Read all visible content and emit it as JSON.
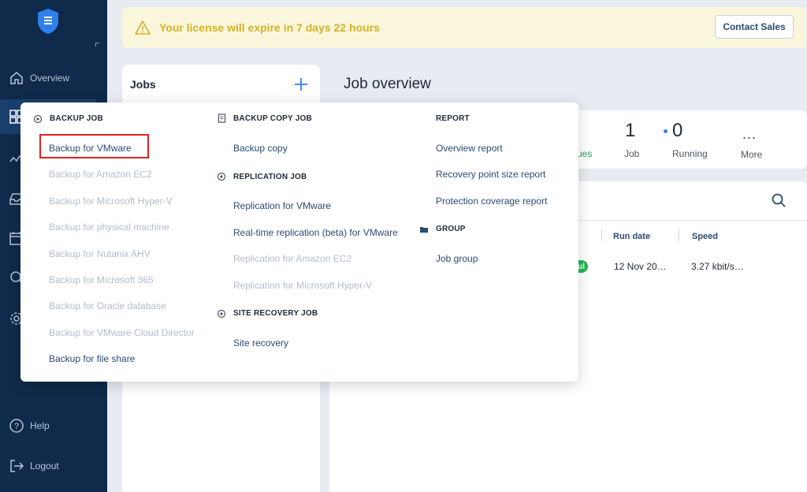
{
  "sidebar": {
    "items": [
      {
        "label": "Overview",
        "icon": "home-icon"
      },
      {
        "label": "",
        "icon": "dashboard-icon"
      },
      {
        "label": "",
        "icon": "activity-icon"
      },
      {
        "label": "",
        "icon": "inbox-icon"
      },
      {
        "label": "",
        "icon": "calendar-icon"
      },
      {
        "label": "",
        "icon": "search-icon"
      },
      {
        "label": "",
        "icon": "gear-icon"
      }
    ],
    "help_label": "Help",
    "logout_label": "Logout"
  },
  "banner": {
    "message": "Your license will expire in 7 days 22 hours",
    "button_label": "Contact Sales"
  },
  "jobs_panel": {
    "title": "Jobs"
  },
  "overview": {
    "title": "Job overview",
    "stats": {
      "issues_label": "ues",
      "job_count": "1",
      "job_label": "Job",
      "running_count": "0",
      "running_label": "Running",
      "more_dots": "...",
      "more_label": "More"
    },
    "table": {
      "columns": [
        "Run date",
        "Speed"
      ],
      "row": {
        "status": "ul",
        "run_date": "12 Nov 20…",
        "speed": "3.27 kbit/s…"
      }
    }
  },
  "menu": {
    "backup_job": {
      "header": "BACKUP JOB",
      "items": [
        {
          "label": "Backup for VMware",
          "enabled": true,
          "highlighted": true
        },
        {
          "label": "Backup for Amazon EC2",
          "enabled": false
        },
        {
          "label": "Backup for Microsoft Hyper-V",
          "enabled": false
        },
        {
          "label": "Backup for physical machine",
          "enabled": false
        },
        {
          "label": "Backup for Nutanix AHV",
          "enabled": false
        },
        {
          "label": "Backup for Microsoft 365",
          "enabled": false
        },
        {
          "label": "Backup for Oracle database",
          "enabled": false
        },
        {
          "label": "Backup for VMware Cloud Director",
          "enabled": false
        },
        {
          "label": "Backup for file share",
          "enabled": true
        }
      ]
    },
    "backup_copy_job": {
      "header": "BACKUP COPY JOB",
      "items": [
        {
          "label": "Backup copy",
          "enabled": true
        }
      ]
    },
    "replication_job": {
      "header": "REPLICATION JOB",
      "items": [
        {
          "label": "Replication for VMware",
          "enabled": true
        },
        {
          "label": "Real-time replication (beta) for VMware",
          "enabled": true
        },
        {
          "label": "Replication for Amazon EC2",
          "enabled": false
        },
        {
          "label": "Replication for Microsoft Hyper-V",
          "enabled": false
        }
      ]
    },
    "site_recovery_job": {
      "header": "SITE RECOVERY JOB",
      "items": [
        {
          "label": "Site recovery",
          "enabled": true
        }
      ]
    },
    "report": {
      "header": "REPORT",
      "items": [
        {
          "label": "Overview report",
          "enabled": true
        },
        {
          "label": "Recovery point size report",
          "enabled": true
        },
        {
          "label": "Protection coverage report",
          "enabled": true
        }
      ]
    },
    "group": {
      "header": "GROUP",
      "items": [
        {
          "label": "Job group",
          "enabled": true
        }
      ]
    }
  },
  "colors": {
    "sidebar_bg": "#0f2a4a",
    "accent": "#2f80ed",
    "link": "#2c4a72",
    "disabled": "#b3bccb",
    "highlight": "#e02020",
    "warning": "#d4b226",
    "success": "#22b84f"
  }
}
